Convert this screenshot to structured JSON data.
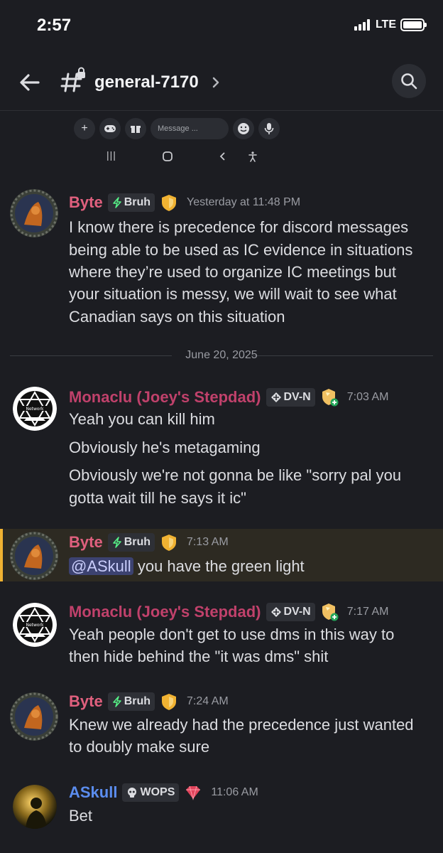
{
  "status_bar": {
    "time": "2:57",
    "network": "LTE"
  },
  "header": {
    "channel_name": "general-7170"
  },
  "embedded_ui": {
    "message_placeholder": "Message ..."
  },
  "date_divider": "June 20, 2025",
  "messages": [
    {
      "author": "Byte",
      "author_color": "#e0607e",
      "tag": "Bruh",
      "tag_icon": "lightning-icon",
      "badge": "shield-icon",
      "timestamp": "Yesterday at 11:48 PM",
      "lines": [
        "I know there is precedence for discord messages",
        "being able to be used as IC evidence in situations",
        "where they’re used to organize IC meetings but",
        "your situation is messy, we will wait to see what",
        "Canadian says on this situation"
      ]
    },
    {
      "author": "Monaclu (Joey's Stepdad)",
      "author_color": "#c0416b",
      "tag": "DV-N",
      "tag_icon": "diamond-cross-icon",
      "badge": "shield-plus-icon",
      "timestamp": "7:03 AM",
      "lines": [
        "Yeah you can kill him",
        "Obviously he's metagaming",
        "Obviously we're not gonna be like \"sorry pal you",
        "gotta wait till he says it ic\""
      ]
    },
    {
      "author": "Byte",
      "author_color": "#e0607e",
      "tag": "Bruh",
      "tag_icon": "lightning-icon",
      "badge": "shield-icon",
      "timestamp": "7:13 AM",
      "mention": "@ASkull",
      "text_after_mention": "you have the green light"
    },
    {
      "author": "Monaclu (Joey's Stepdad)",
      "author_color": "#c0416b",
      "tag": "DV-N",
      "tag_icon": "diamond-cross-icon",
      "badge": "shield-plus-icon",
      "timestamp": "7:17 AM",
      "lines": [
        "Yeah people don't get to use dms in this way to",
        "then hide behind the \"it was dms\" shit"
      ]
    },
    {
      "author": "Byte",
      "author_color": "#e0607e",
      "tag": "Bruh",
      "tag_icon": "lightning-icon",
      "badge": "shield-icon",
      "timestamp": "7:24 AM",
      "lines": [
        "Knew we already had the precedence just wanted",
        "to doubly make sure"
      ]
    },
    {
      "author": "ASkull",
      "author_color": "#5b8def",
      "tag": "WOPS",
      "tag_icon": "skull-icon",
      "badge": "gem-icon",
      "timestamp": "11:06 AM",
      "lines": [
        "Bet"
      ]
    }
  ],
  "colors": {
    "background": "#1c1d22",
    "highlight_bar": "#f0b232",
    "mention_bg": "#3c4270"
  }
}
